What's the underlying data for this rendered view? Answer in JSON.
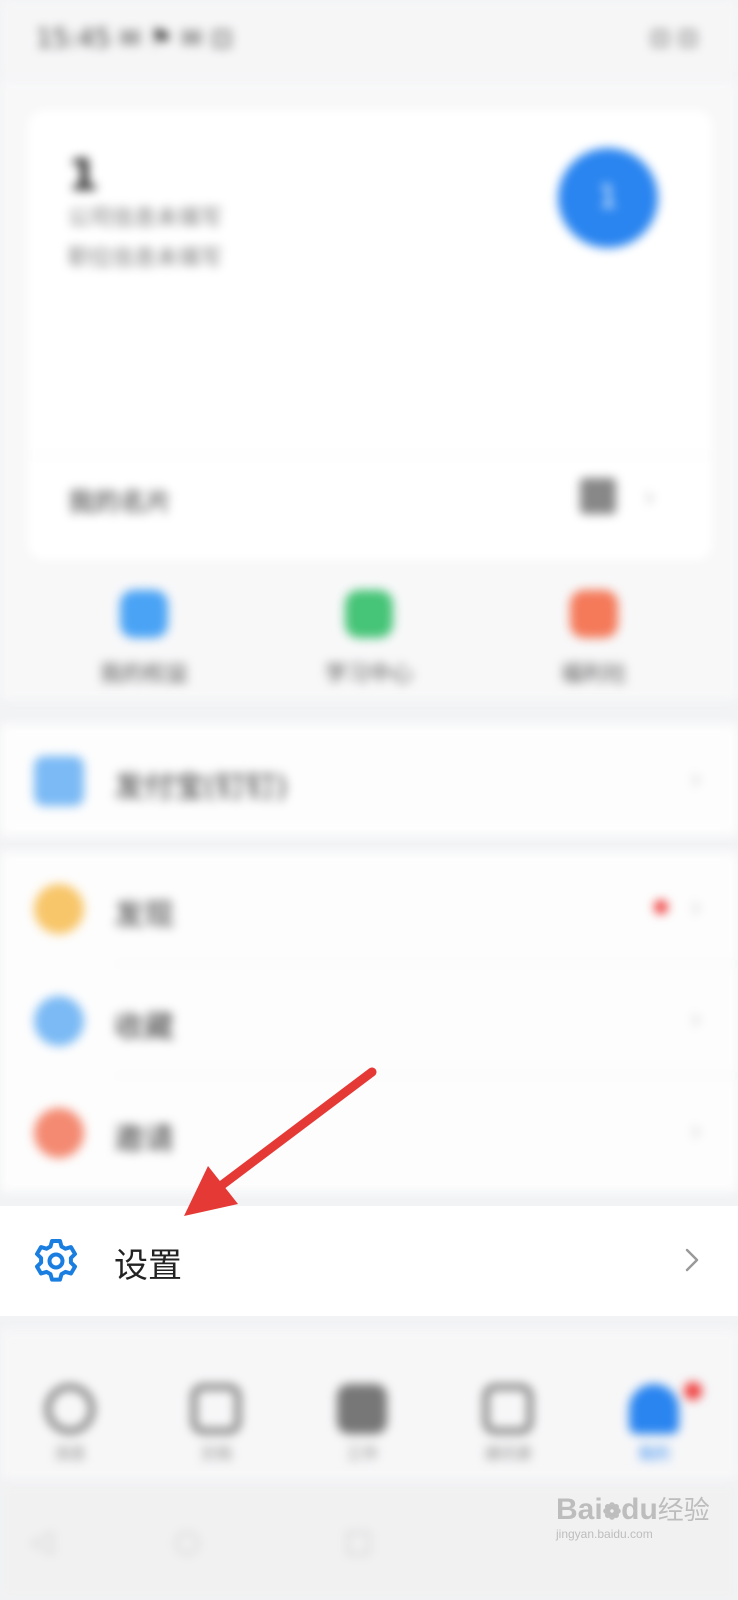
{
  "status_bar": {
    "time": "15:45 ✉ ⚑ ✉ ⊡",
    "battery": "⊡ ⊡"
  },
  "profile": {
    "name": "1",
    "line1": "公司信息未填写",
    "line2": "职位信息未填写",
    "avatar_text": "1",
    "card_label": "我的名片"
  },
  "quick_actions": [
    {
      "label": "我的权益",
      "color": "#4aa3f5"
    },
    {
      "label": "学习中心",
      "color": "#46c477"
    },
    {
      "label": "福利社",
      "color": "#f47a5a"
    }
  ],
  "list_group_1": [
    {
      "label": "发付宝(钉钉)",
      "icon": "card-icon",
      "color": "#7bbaf5"
    }
  ],
  "list_group_2": [
    {
      "label": "发现",
      "icon": "discover-icon",
      "color": "#f8c66a"
    },
    {
      "label": "收藏",
      "icon": "favorites-icon",
      "color": "#7bbaf5"
    },
    {
      "label": "邀请",
      "icon": "invite-icon",
      "color": "#f48a72"
    }
  ],
  "settings": {
    "label": "设置",
    "icon": "gear-icon",
    "accent": "#1a7ee0"
  },
  "tab_bar": [
    {
      "label": "消息",
      "icon": "message-icon"
    },
    {
      "label": "文档",
      "icon": "docs-icon"
    },
    {
      "label": "工作",
      "icon": "work-icon"
    },
    {
      "label": "通讯录",
      "icon": "contacts-icon"
    },
    {
      "label": "我的",
      "icon": "me-icon",
      "active": true
    }
  ],
  "nav_bar": {
    "back": "◁",
    "home": "○",
    "recent": "□"
  },
  "watermark": {
    "brand_a": "Bai",
    "brand_b": "du",
    "brand_c": "经验",
    "url": "jingyan.baidu.com"
  },
  "colors": {
    "accent_blue": "#2a85f0",
    "arrow_red": "#e53935"
  }
}
